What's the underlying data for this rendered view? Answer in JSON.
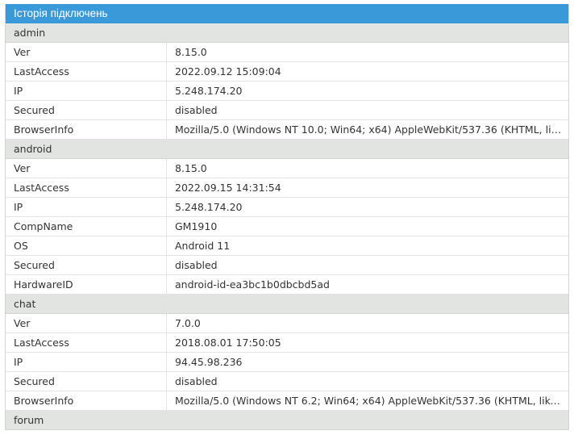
{
  "header": {
    "title": "Історія підключень"
  },
  "groups": [
    {
      "name": "admin",
      "rows": [
        {
          "key": "Ver",
          "value": "8.15.0"
        },
        {
          "key": "LastAccess",
          "value": "2022.09.12 15:09:04"
        },
        {
          "key": "IP",
          "value": "5.248.174.20"
        },
        {
          "key": "Secured",
          "value": "disabled"
        },
        {
          "key": "BrowserInfo",
          "value": "Mozilla/5.0 (Windows NT 10.0; Win64; x64) AppleWebKit/537.36 (KHTML, like G..."
        }
      ]
    },
    {
      "name": "android",
      "rows": [
        {
          "key": "Ver",
          "value": "8.15.0"
        },
        {
          "key": "LastAccess",
          "value": "2022.09.15 14:31:54"
        },
        {
          "key": "IP",
          "value": "5.248.174.20"
        },
        {
          "key": "CompName",
          "value": "GM1910"
        },
        {
          "key": "OS",
          "value": "Android 11"
        },
        {
          "key": "Secured",
          "value": "disabled"
        },
        {
          "key": "HardwareID",
          "value": "android-id-ea3bc1b0dbcbd5ad"
        }
      ]
    },
    {
      "name": "chat",
      "rows": [
        {
          "key": "Ver",
          "value": "7.0.0"
        },
        {
          "key": "LastAccess",
          "value": "2018.08.01 17:50:05"
        },
        {
          "key": "IP",
          "value": "94.45.98.236"
        },
        {
          "key": "Secured",
          "value": "disabled"
        },
        {
          "key": "BrowserInfo",
          "value": "Mozilla/5.0 (Windows NT 6.2; Win64; x64) AppleWebKit/537.36 (KHTML, like Ge..."
        }
      ]
    },
    {
      "name": "forum",
      "rows": []
    }
  ]
}
